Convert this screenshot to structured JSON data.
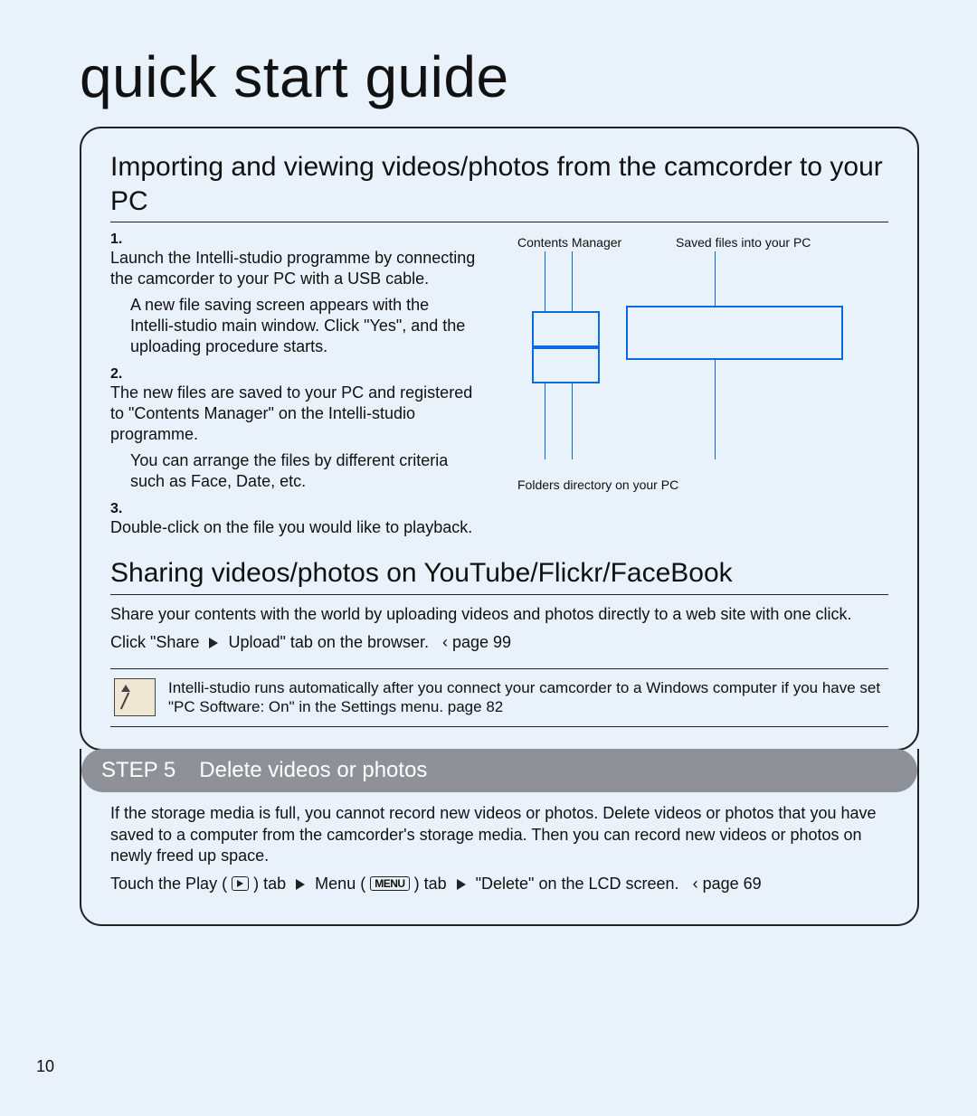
{
  "pageTitle": "quick start guide",
  "pageNumber": "10",
  "sectionA": {
    "heading": "Importing and viewing videos/photos from the camcorder to your PC",
    "items": [
      {
        "num": "1.",
        "text": "Launch the Intelli-studio programme by connecting the camcorder to your PC with a USB cable.",
        "sub": "A new ﬁle saving screen appears with the Intelli-studio main window. Click \"Yes\", and the uploading procedure starts."
      },
      {
        "num": "2.",
        "text": "The new ﬁles are saved to your PC and registered to \"Contents Manager\" on the Intelli-studio programme.",
        "sub": "You can arrange the ﬁles by different criteria such as Face, Date, etc."
      },
      {
        "num": "3.",
        "text": "Double-click on the ﬁle you would like to playback.",
        "sub": ""
      }
    ],
    "diagram": {
      "label1": "Contents Manager",
      "label2": "Saved ﬁles into your PC",
      "label3": "Folders directory on your PC"
    }
  },
  "sectionB": {
    "heading": "Sharing videos/photos on YouTube/Flickr/FaceBook",
    "body": "Share your contents with the world by uploading videos and photos directly to a web site with one click.",
    "cta": {
      "t1": "Click \"Share",
      "t2": "Upload\" tab on the browser.",
      "ref": "page 99"
    },
    "note": "Intelli-studio runs automatically after you connect your camcorder to a Windows computer if you have set \"PC Software: On\" in the Settings menu.  page 82"
  },
  "step": {
    "label": "STEP 5",
    "title": "Delete videos or photos",
    "body": "If the storage media is full, you cannot record new videos or photos. Delete videos or photos that you have saved to a computer from the camcorder's storage media. Then you can record new videos or photos on newly freed up space.",
    "hint": {
      "p1": "Touch the Play (",
      "p2": ") tab",
      "p3": "Menu (",
      "p4": ") tab",
      "p5": "\"Delete\" on the LCD screen.",
      "ref": "page 69"
    }
  }
}
